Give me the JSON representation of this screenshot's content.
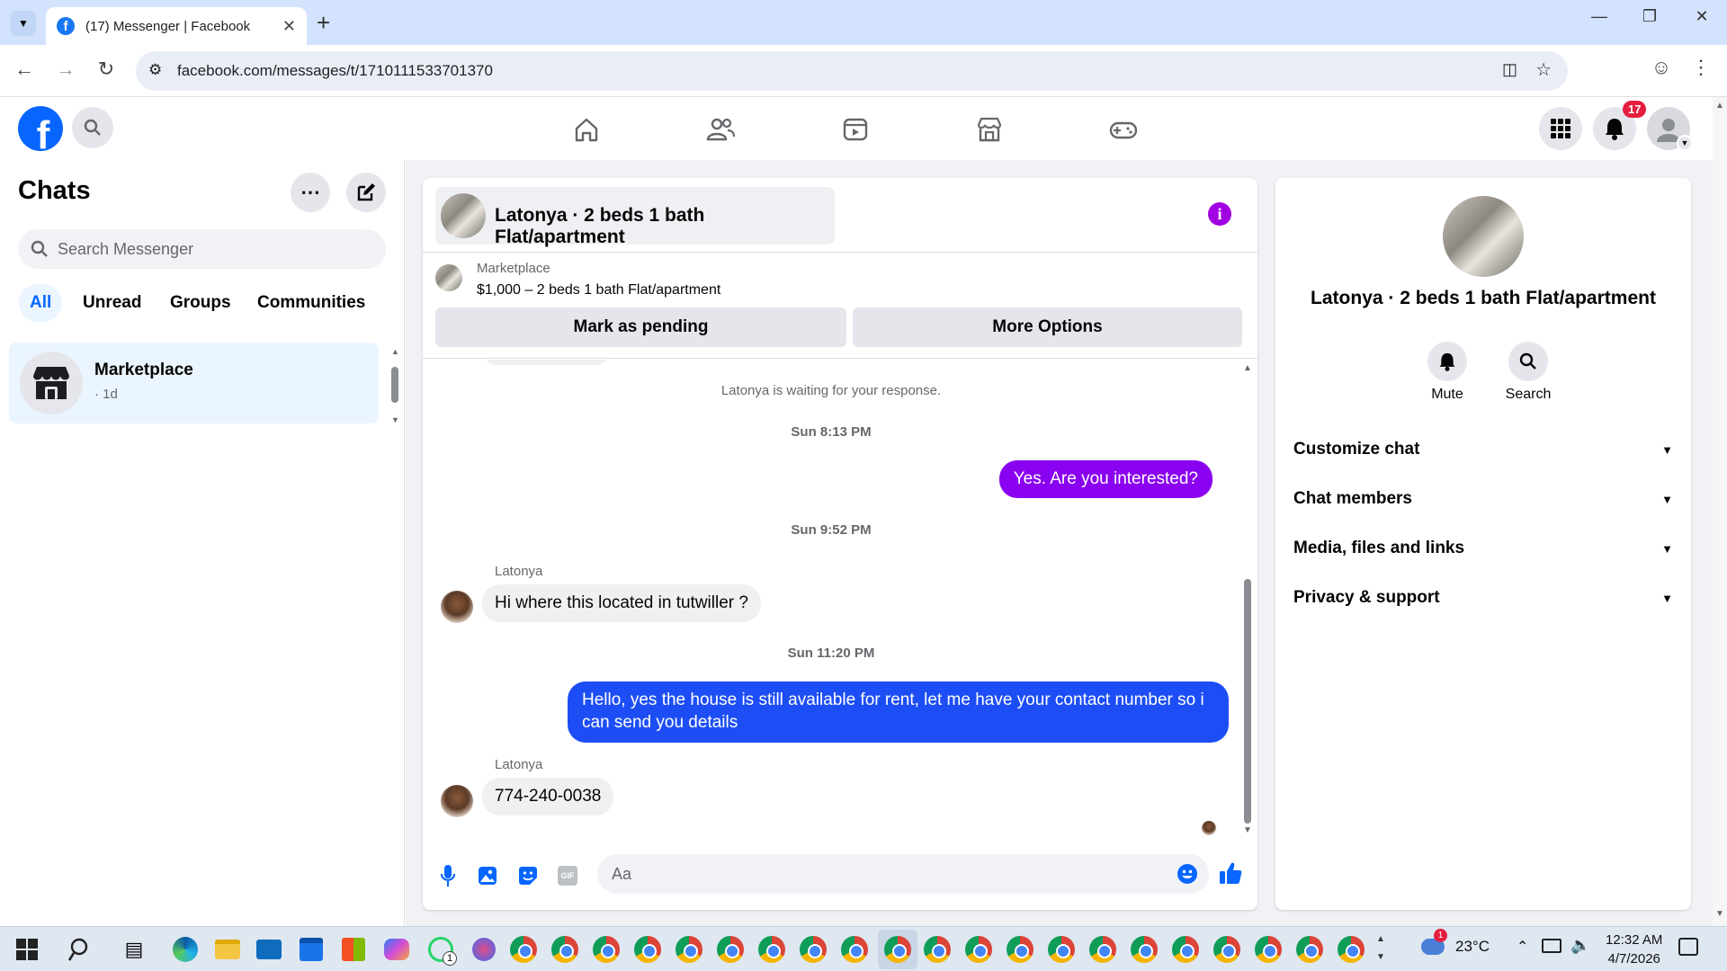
{
  "browser": {
    "tab_title": "(17) Messenger | Facebook",
    "url": "facebook.com/messages/t/1710111533701370",
    "new_tab": "+",
    "favicon": "f"
  },
  "fb_header": {
    "notification_count": "17",
    "nav_icons": [
      "home-icon",
      "friends-icon",
      "video-icon",
      "marketplace-icon",
      "gaming-icon"
    ]
  },
  "sidebar": {
    "title": "Chats",
    "search_placeholder": "Search Messenger",
    "filters": [
      "All",
      "Unread",
      "Groups",
      "Communities"
    ],
    "active_filter": "All",
    "chats": [
      {
        "name": "Marketplace",
        "meta": "· 1d"
      }
    ]
  },
  "conversation": {
    "title": "Latonya · 2 beds 1 bath Flat/apartment",
    "listing": {
      "source": "Marketplace",
      "summary": "$1,000 – 2 beds 1 bath Flat/apartment",
      "pending_button": "Mark as pending",
      "options_button": "More Options"
    },
    "waiting_notice": "Latonya is waiting for your response.",
    "messages": [
      {
        "timestamp": "Sun 8:13 PM",
        "direction": "out",
        "text": "Yes. Are you interested?",
        "color": "#8a00f0"
      },
      {
        "timestamp": "Sun 9:52 PM",
        "direction": "in",
        "sender": "Latonya",
        "text": "Hi where this located in tutwiller ?"
      },
      {
        "timestamp": "Sun 11:20 PM",
        "direction": "out",
        "text": "Hello, yes the house is still available for rent, let me have your contact number so i can send you details",
        "color": "#1d4ef5"
      },
      {
        "direction": "in",
        "sender": "Latonya",
        "text": "774-240-0038"
      }
    ],
    "composer_placeholder": "Aa"
  },
  "details_panel": {
    "name": "Latonya · 2 beds 1 bath Flat/apartment",
    "actions": [
      "Mute",
      "Search"
    ],
    "sections": [
      "Customize chat",
      "Chat members",
      "Media, files and links",
      "Privacy & support"
    ]
  },
  "taskbar": {
    "weather": "23°C",
    "weather_badge": "1",
    "whatsapp_badge": "1",
    "time": "12:32 AM",
    "date": "4/7/2026"
  },
  "colors": {
    "fb_blue": "#0866ff",
    "purple_accent": "#a100e0",
    "out_bubble_purple": "#8a00f0",
    "out_bubble_blue": "#1d4ef5"
  }
}
